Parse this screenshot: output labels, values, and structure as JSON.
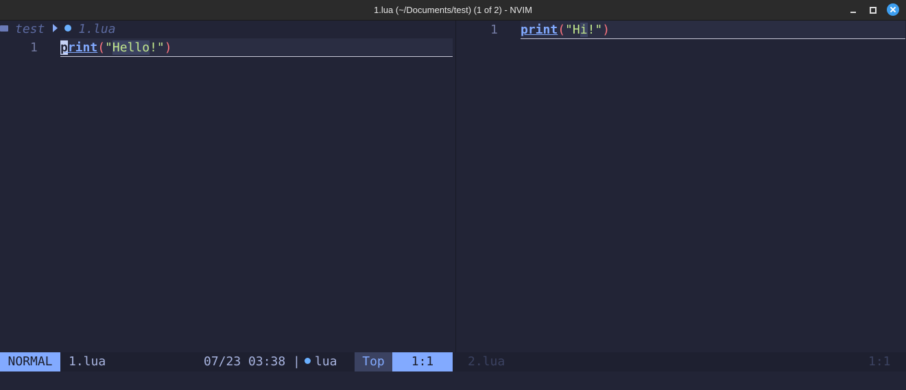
{
  "window": {
    "title": "1.lua (~/Documents/test) (1 of 2) - NVIM"
  },
  "left_pane": {
    "winbar": {
      "folder": "test",
      "file": "1.lua"
    },
    "line_number": "1",
    "code": {
      "func": "print",
      "open_paren": "(",
      "string": "\"Hello!\"",
      "close_paren": ")"
    }
  },
  "right_pane": {
    "line_number": "1",
    "code": {
      "func": "print",
      "open_paren": "(",
      "string": "\"Hi!\"",
      "close_paren": ")"
    }
  },
  "statusline": {
    "mode": "NORMAL",
    "filename": "1.lua",
    "datetime": "07/23 03:38 |",
    "filetype": "lua",
    "position_percent": "Top",
    "position_linecol": "1:1",
    "inactive_filename": "2.lua",
    "inactive_position": "1:1"
  },
  "colors": {
    "background": "#222436",
    "accent": "#82aaff",
    "string": "#c3e88d",
    "paren": "#ff757f"
  }
}
